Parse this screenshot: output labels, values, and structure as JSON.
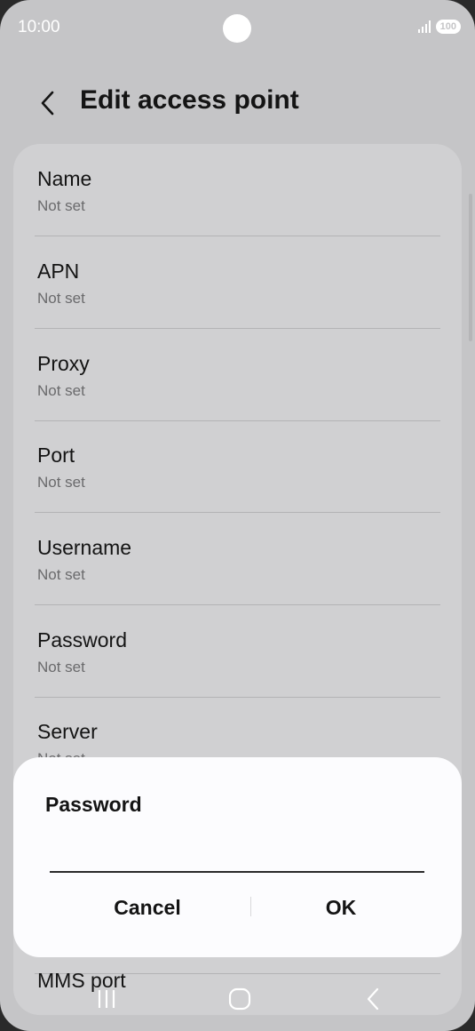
{
  "status_bar": {
    "time": "10:00",
    "battery": "100"
  },
  "header": {
    "title": "Edit access point"
  },
  "list": {
    "items": [
      {
        "title": "Name",
        "subtitle": "Not set"
      },
      {
        "title": "APN",
        "subtitle": "Not set"
      },
      {
        "title": "Proxy",
        "subtitle": "Not set"
      },
      {
        "title": "Port",
        "subtitle": "Not set"
      },
      {
        "title": "Username",
        "subtitle": "Not set"
      },
      {
        "title": "Password",
        "subtitle": "Not set"
      },
      {
        "title": "Server",
        "subtitle": "Not set"
      },
      {
        "title": "MMS port",
        "subtitle": ""
      }
    ]
  },
  "dialog": {
    "title": "Password",
    "input_value": "",
    "cancel_label": "Cancel",
    "ok_label": "OK"
  },
  "nav": {
    "icons": [
      "recent-apps-icon",
      "home-icon",
      "back-icon"
    ]
  },
  "colors": {
    "background": "#c5c5c7",
    "dialog": "#fcfcfe",
    "text": "#141414"
  }
}
